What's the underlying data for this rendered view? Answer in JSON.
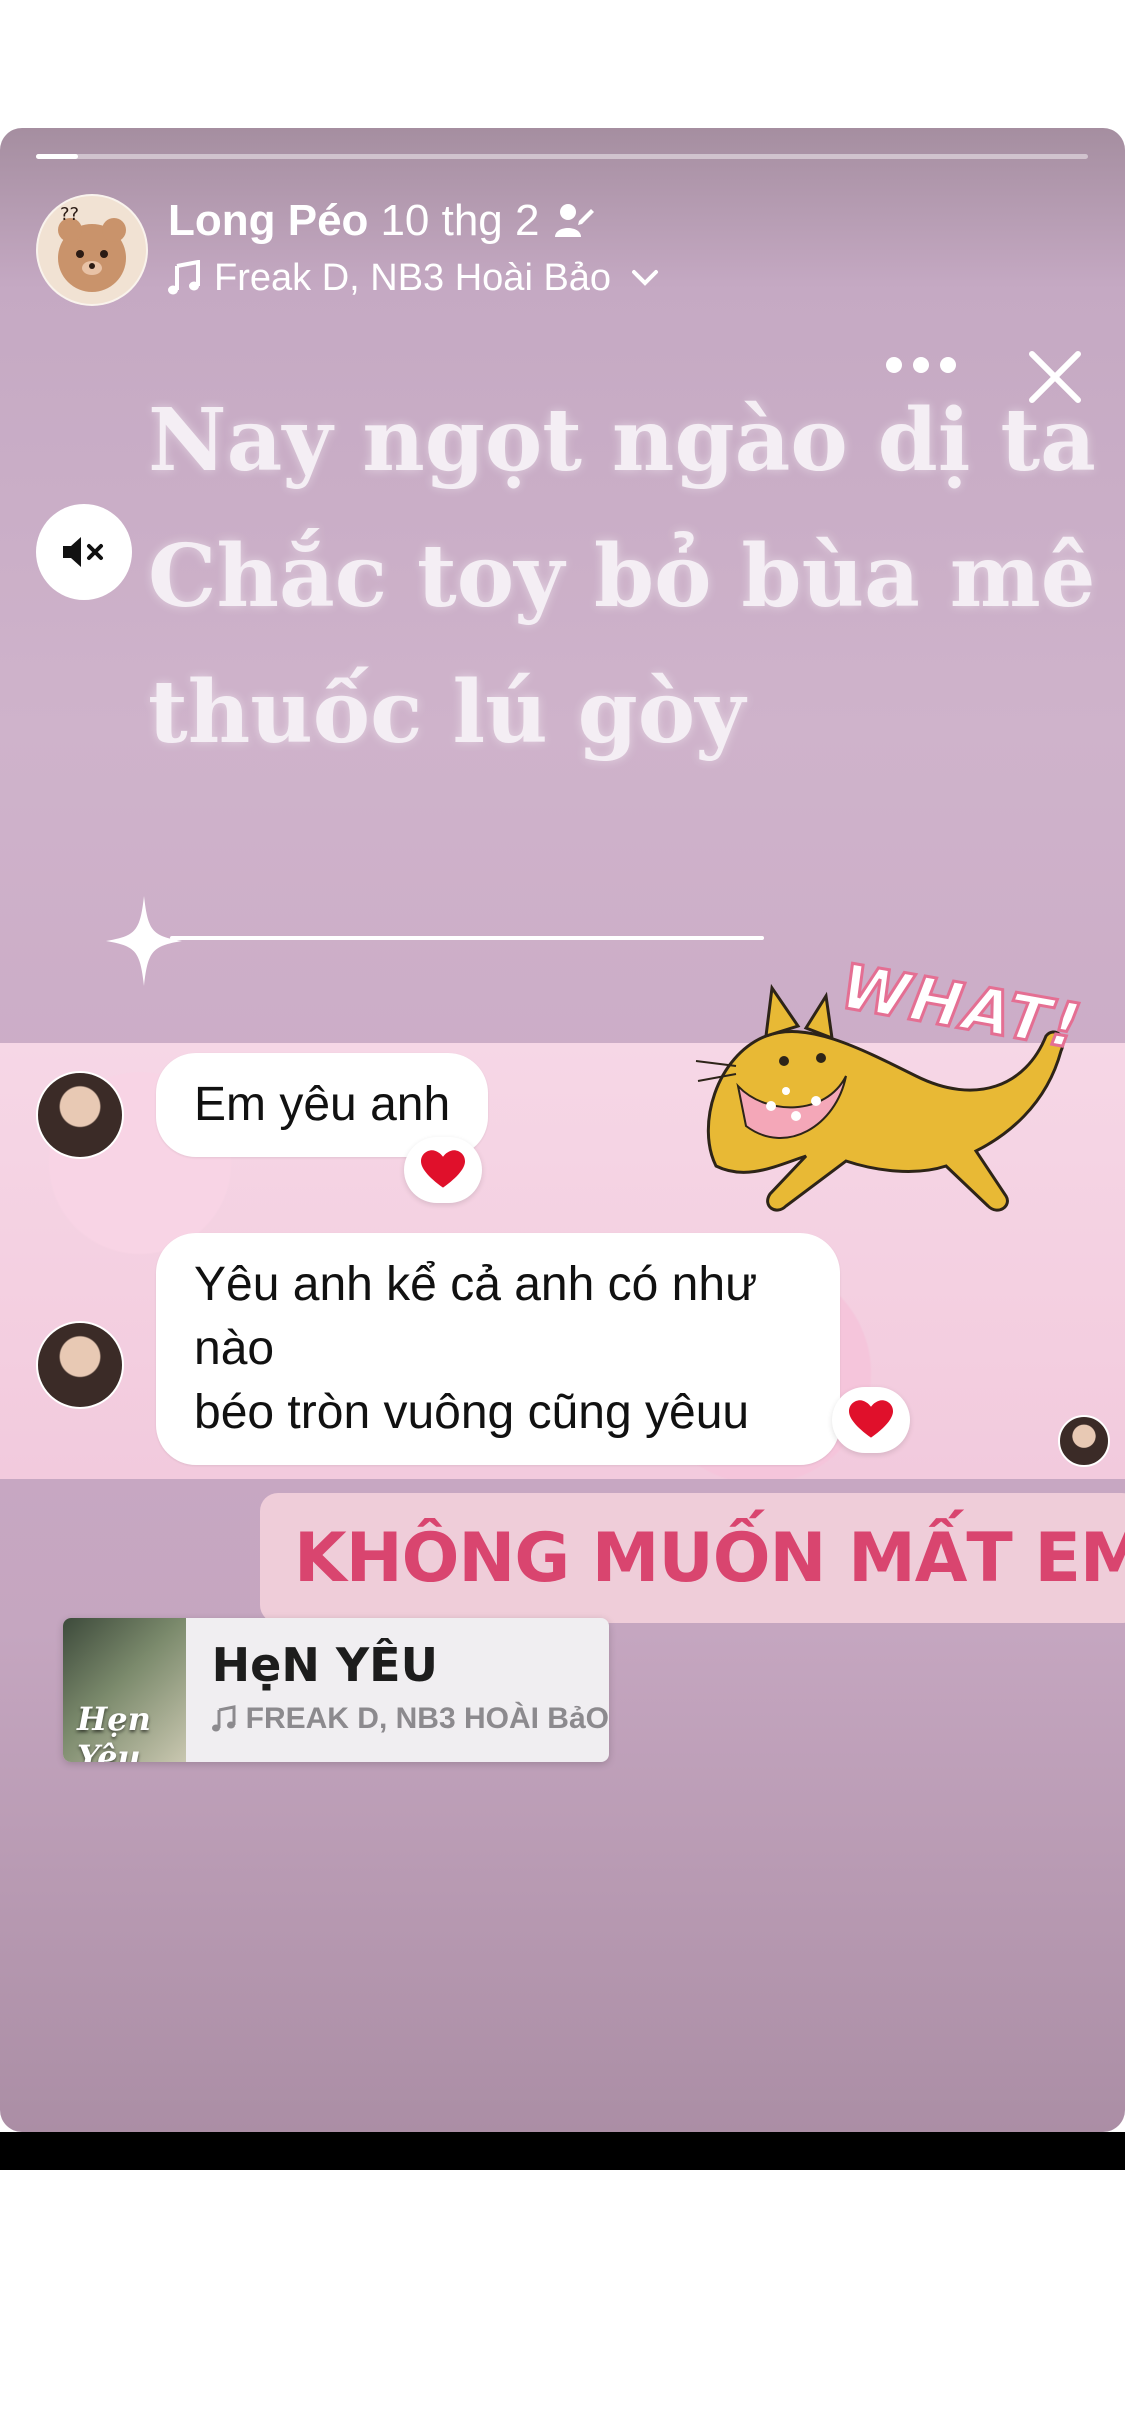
{
  "story": {
    "progress": 0.04,
    "user_name": "Long Péo",
    "post_time": "10 thg 2",
    "music_label": "Freak D, NB3 Hoài Bảo",
    "caption_lines": [
      "Nay ngọt ngào dị ta",
      "Chắc toy bỏ bùa mê",
      "thuốc lú gòy"
    ]
  },
  "chat": {
    "message_1": "Em yêu anh",
    "message_2_line_1": "Yêu anh kể cả anh có như nào",
    "message_2_line_2": "béo tròn vuông cũng yêuu"
  },
  "sticker": {
    "what_text": "WHAT!"
  },
  "banner": {
    "text": "KHÔNG MUỐN MẤT EM"
  },
  "music_card": {
    "song_title": "HẹN YÊU",
    "artist": "FREAK D, NB3 HOÀI BảO",
    "album_text": "Hẹn Yêu"
  },
  "colors": {
    "banner_text": "#d9456f",
    "heart": "#e0102b",
    "story_bg": "#cfb3cb"
  }
}
